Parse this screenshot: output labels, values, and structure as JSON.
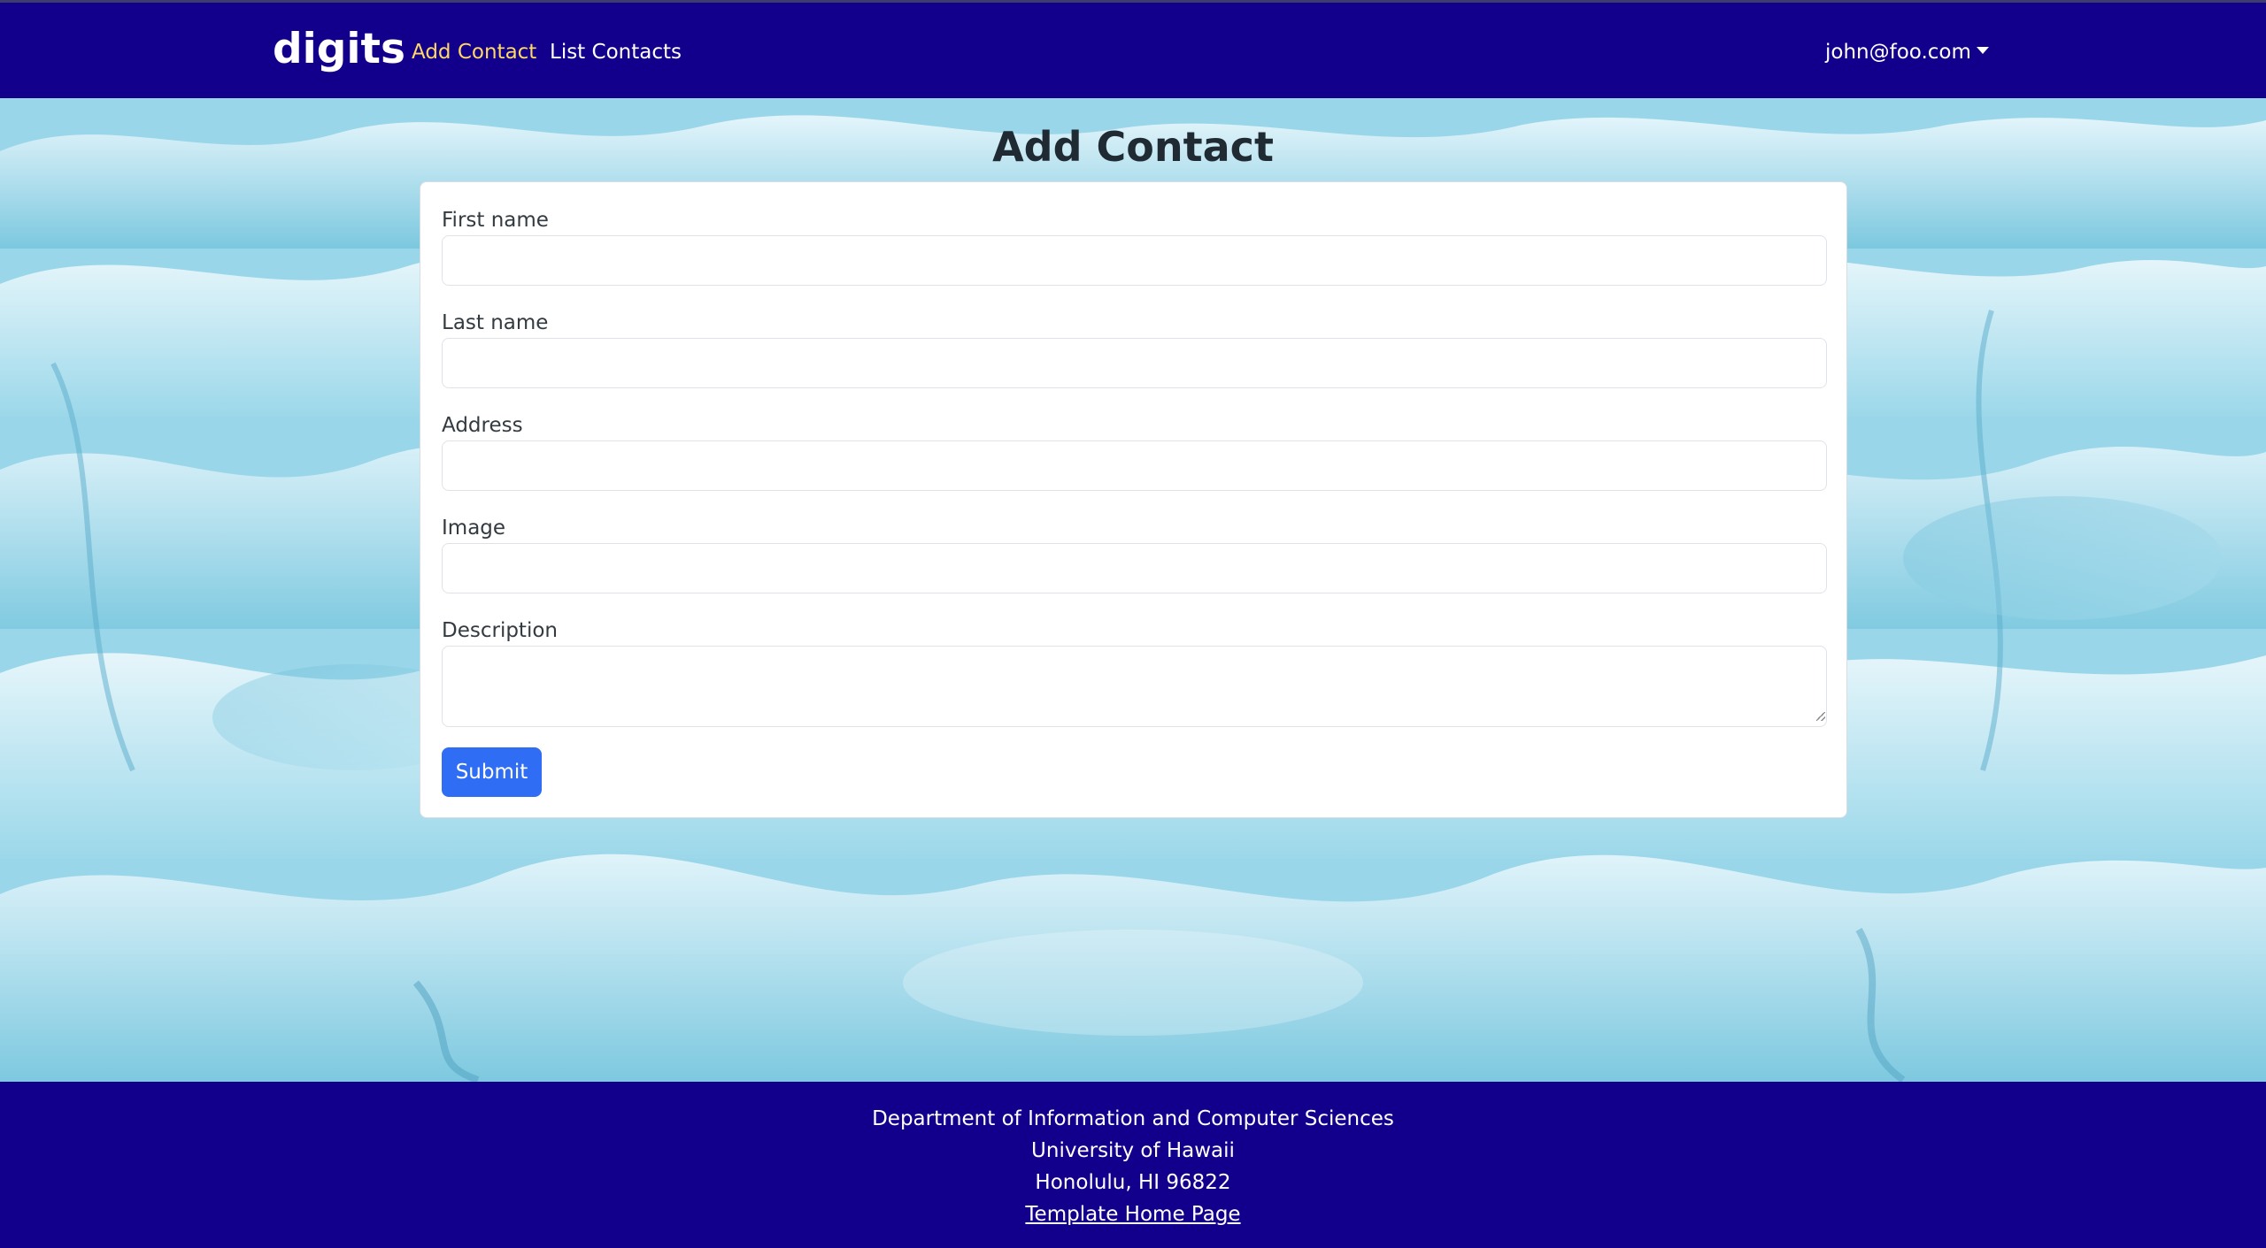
{
  "navbar": {
    "brand": "digits",
    "links": [
      {
        "label": "Add Contact",
        "active": true
      },
      {
        "label": "List Contacts",
        "active": false
      }
    ],
    "user": "john@foo.com"
  },
  "page": {
    "title": "Add Contact"
  },
  "form": {
    "fields": [
      {
        "label": "First name",
        "value": ""
      },
      {
        "label": "Last name",
        "value": ""
      },
      {
        "label": "Address",
        "value": ""
      },
      {
        "label": "Image",
        "value": ""
      },
      {
        "label": "Description",
        "value": ""
      }
    ],
    "submit_label": "Submit"
  },
  "footer": {
    "line1": "Department of Information and Computer Sciences",
    "line2": "University of Hawaii",
    "line3": "Honolulu, HI 96822",
    "link": "Template Home Page"
  },
  "colors": {
    "navbar_bg": "#12008c",
    "active_link": "#ffd966",
    "button_primary": "#2f6df5"
  },
  "icons": {
    "user_menu": "chevron-down-icon"
  }
}
